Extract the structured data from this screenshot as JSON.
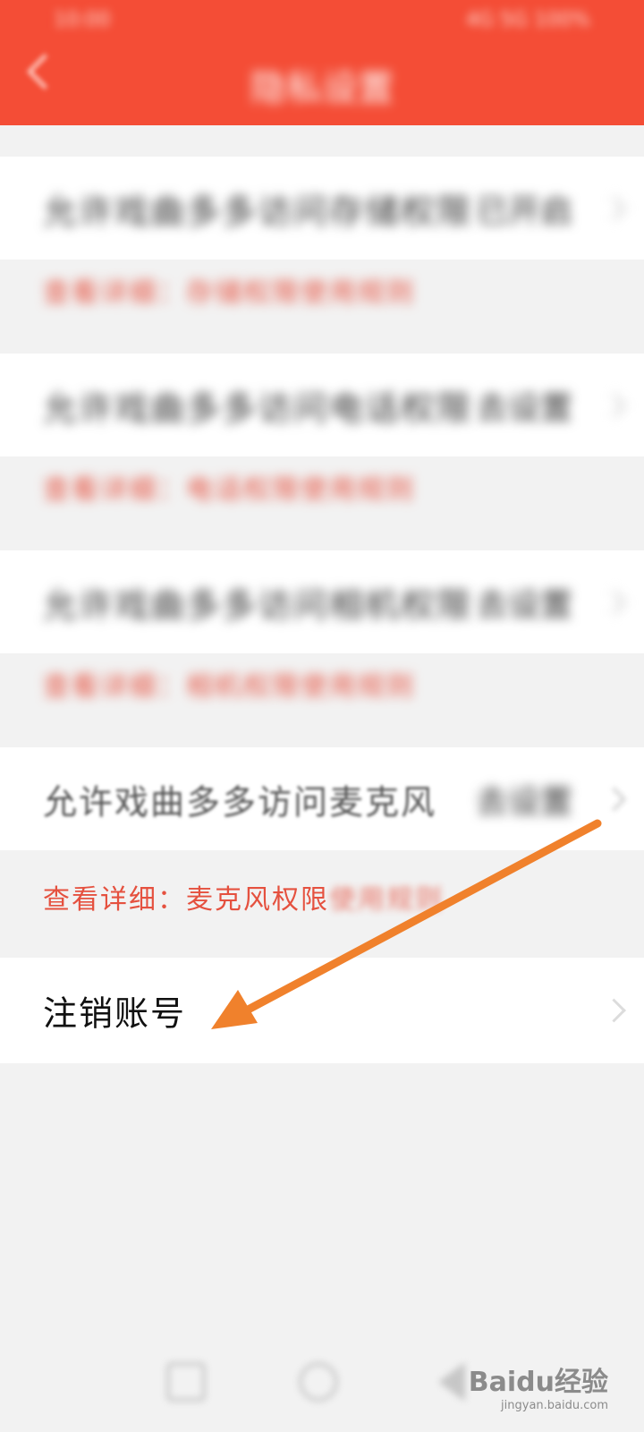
{
  "status_bar": {
    "left": "10:00",
    "right": "4G 5G 100%"
  },
  "header": {
    "title": "隐私设置"
  },
  "items": [
    {
      "label": "允许戏曲多多访问存储权限",
      "value": "已开启",
      "detail": "查看详细：存储权限使用规则"
    },
    {
      "label": "允许戏曲多多访问电话权限",
      "value": "去设置",
      "detail": "查看详细：电话权限使用规则"
    },
    {
      "label": "允许戏曲多多访问相机权限",
      "value": "去设置",
      "detail": "查看详细：相机权限使用规则"
    },
    {
      "label": "允许戏曲多多访问麦克风",
      "value": "去设置",
      "detail_a": "查看详细：麦克风权限",
      "detail_b": "使用规则"
    },
    {
      "label": "注销账号"
    }
  ],
  "annotation": {
    "color": "#f0812c"
  },
  "watermark": {
    "main": "Baidu经验",
    "sub": "jingyan.baidu.com"
  }
}
